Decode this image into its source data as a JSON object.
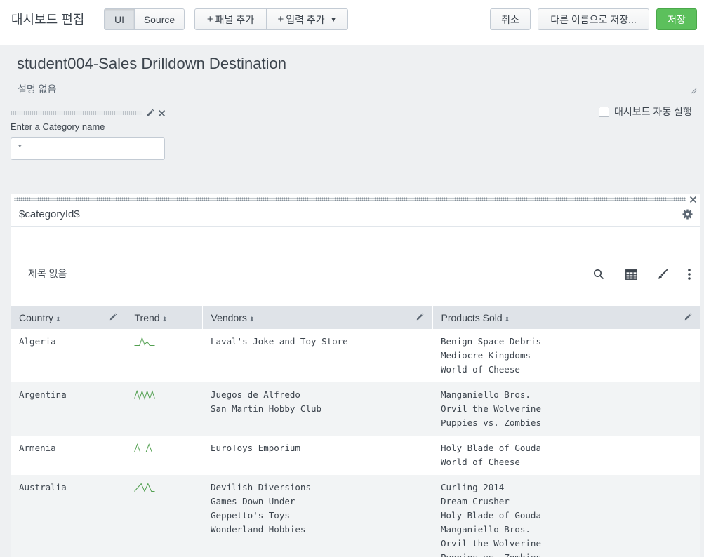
{
  "topbar": {
    "title": "대시보드 편집",
    "mode_tabs": [
      {
        "label": "UI",
        "active": true
      },
      {
        "label": "Source",
        "active": false
      }
    ],
    "add_panel_label": "패널 추가",
    "add_input_label": "입력 추가",
    "cancel_label": "취소",
    "save_as_label": "다른 이름으로 저장...",
    "save_label": "저장",
    "save_color": "#5cc05c"
  },
  "dashboard": {
    "title": "student004-Sales Drilldown Destination",
    "description": "설명 없음",
    "autorun_label": "대시보드 자동 실행",
    "autorun_checked": false
  },
  "input": {
    "label": "Enter a Category name",
    "value": "*"
  },
  "panel": {
    "title": "$categoryId$",
    "viz_title": "제목 없음",
    "table": {
      "columns": [
        "Country",
        "Trend",
        "Vendors",
        "Products Sold"
      ],
      "rows": [
        {
          "country": "Algeria",
          "trend": [
            0,
            0,
            0,
            1,
            0.1,
            0.5,
            0,
            0,
            0
          ],
          "vendors": [
            "Laval's Joke and Toy Store"
          ],
          "products": [
            "Benign Space Debris",
            "Mediocre Kingdoms",
            "World of Cheese"
          ]
        },
        {
          "country": "Argentina",
          "trend": [
            0,
            1,
            0,
            1,
            0,
            1,
            0,
            1,
            0
          ],
          "vendors": [
            "Juegos de Alfredo",
            "San Martin Hobby Club"
          ],
          "products": [
            "Manganiello Bros.",
            "Orvil the Wolverine",
            "Puppies vs. Zombies"
          ]
        },
        {
          "country": "Armenia",
          "trend": [
            0,
            1,
            0,
            0,
            0,
            1,
            0,
            0
          ],
          "vendors": [
            "EuroToys Emporium"
          ],
          "products": [
            "Holy Blade of Gouda",
            "World of Cheese"
          ]
        },
        {
          "country": "Australia",
          "trend": [
            0,
            0.5,
            1,
            0,
            1,
            0,
            0
          ],
          "vendors": [
            "Devilish Diversions",
            "Games Down Under",
            "Geppetto's Toys",
            "Wonderland Hobbies"
          ],
          "products": [
            "Curling 2014",
            "Dream Crusher",
            "Holy Blade of Gouda",
            "Manganiello Bros.",
            "Orvil the Wolverine",
            "Puppies vs. Zombies"
          ]
        }
      ]
    },
    "sparkline_color": "#53a051"
  }
}
